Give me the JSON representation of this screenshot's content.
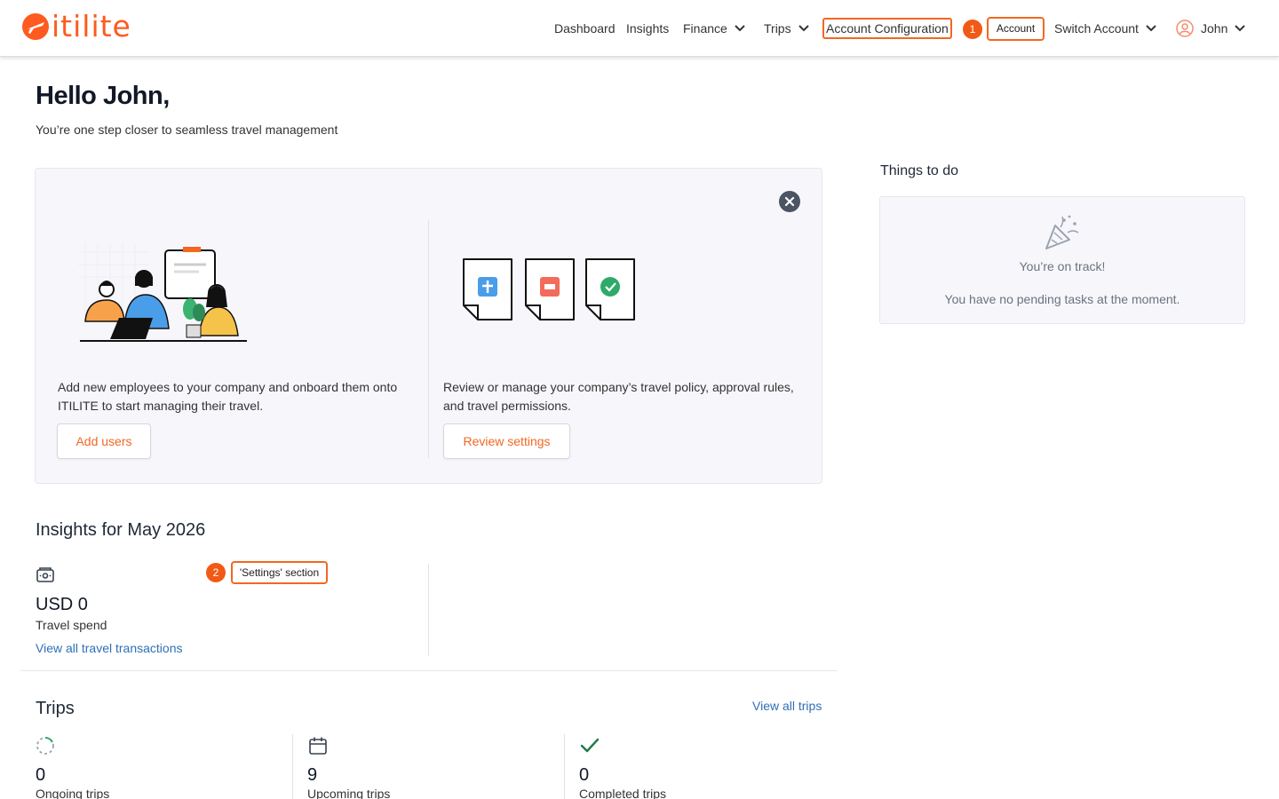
{
  "brand": {
    "name": "itilite",
    "color": "#f26722"
  },
  "nav": {
    "dashboard": "Dashboard",
    "insights": "Insights",
    "finance": "Finance",
    "trips": "Trips",
    "account_configuration": "Account Configuration",
    "switch_account": "Switch Account",
    "user": "John"
  },
  "annotations": [
    {
      "number": "1",
      "label": "Account"
    },
    {
      "number": "2",
      "label": "'Settings' section"
    }
  ],
  "greeting": {
    "title": "Hello John,",
    "subtitle": "You’re one step closer to seamless travel management"
  },
  "onboard": {
    "add_users_text": "Add new employees to your company and onboard them onto ITILITE to start managing their travel.",
    "add_users_button": "Add users",
    "review_text": "Review or manage your company’s travel policy, approval rules, and travel permissions.",
    "review_button": "Review settings"
  },
  "todo": {
    "title": "Things to do",
    "status": "You’re on track!",
    "message": "You have no pending tasks at the moment."
  },
  "insights": {
    "title": "Insights for May 2026",
    "amount": "USD 0",
    "amount_label": "Travel spend",
    "link": "View all travel transactions"
  },
  "trips": {
    "title": "Trips",
    "view_all": "View all trips",
    "stats": [
      {
        "value": "0",
        "label": "Ongoing trips"
      },
      {
        "value": "9",
        "label": "Upcoming trips"
      },
      {
        "value": "0",
        "label": "Completed trips"
      }
    ]
  }
}
